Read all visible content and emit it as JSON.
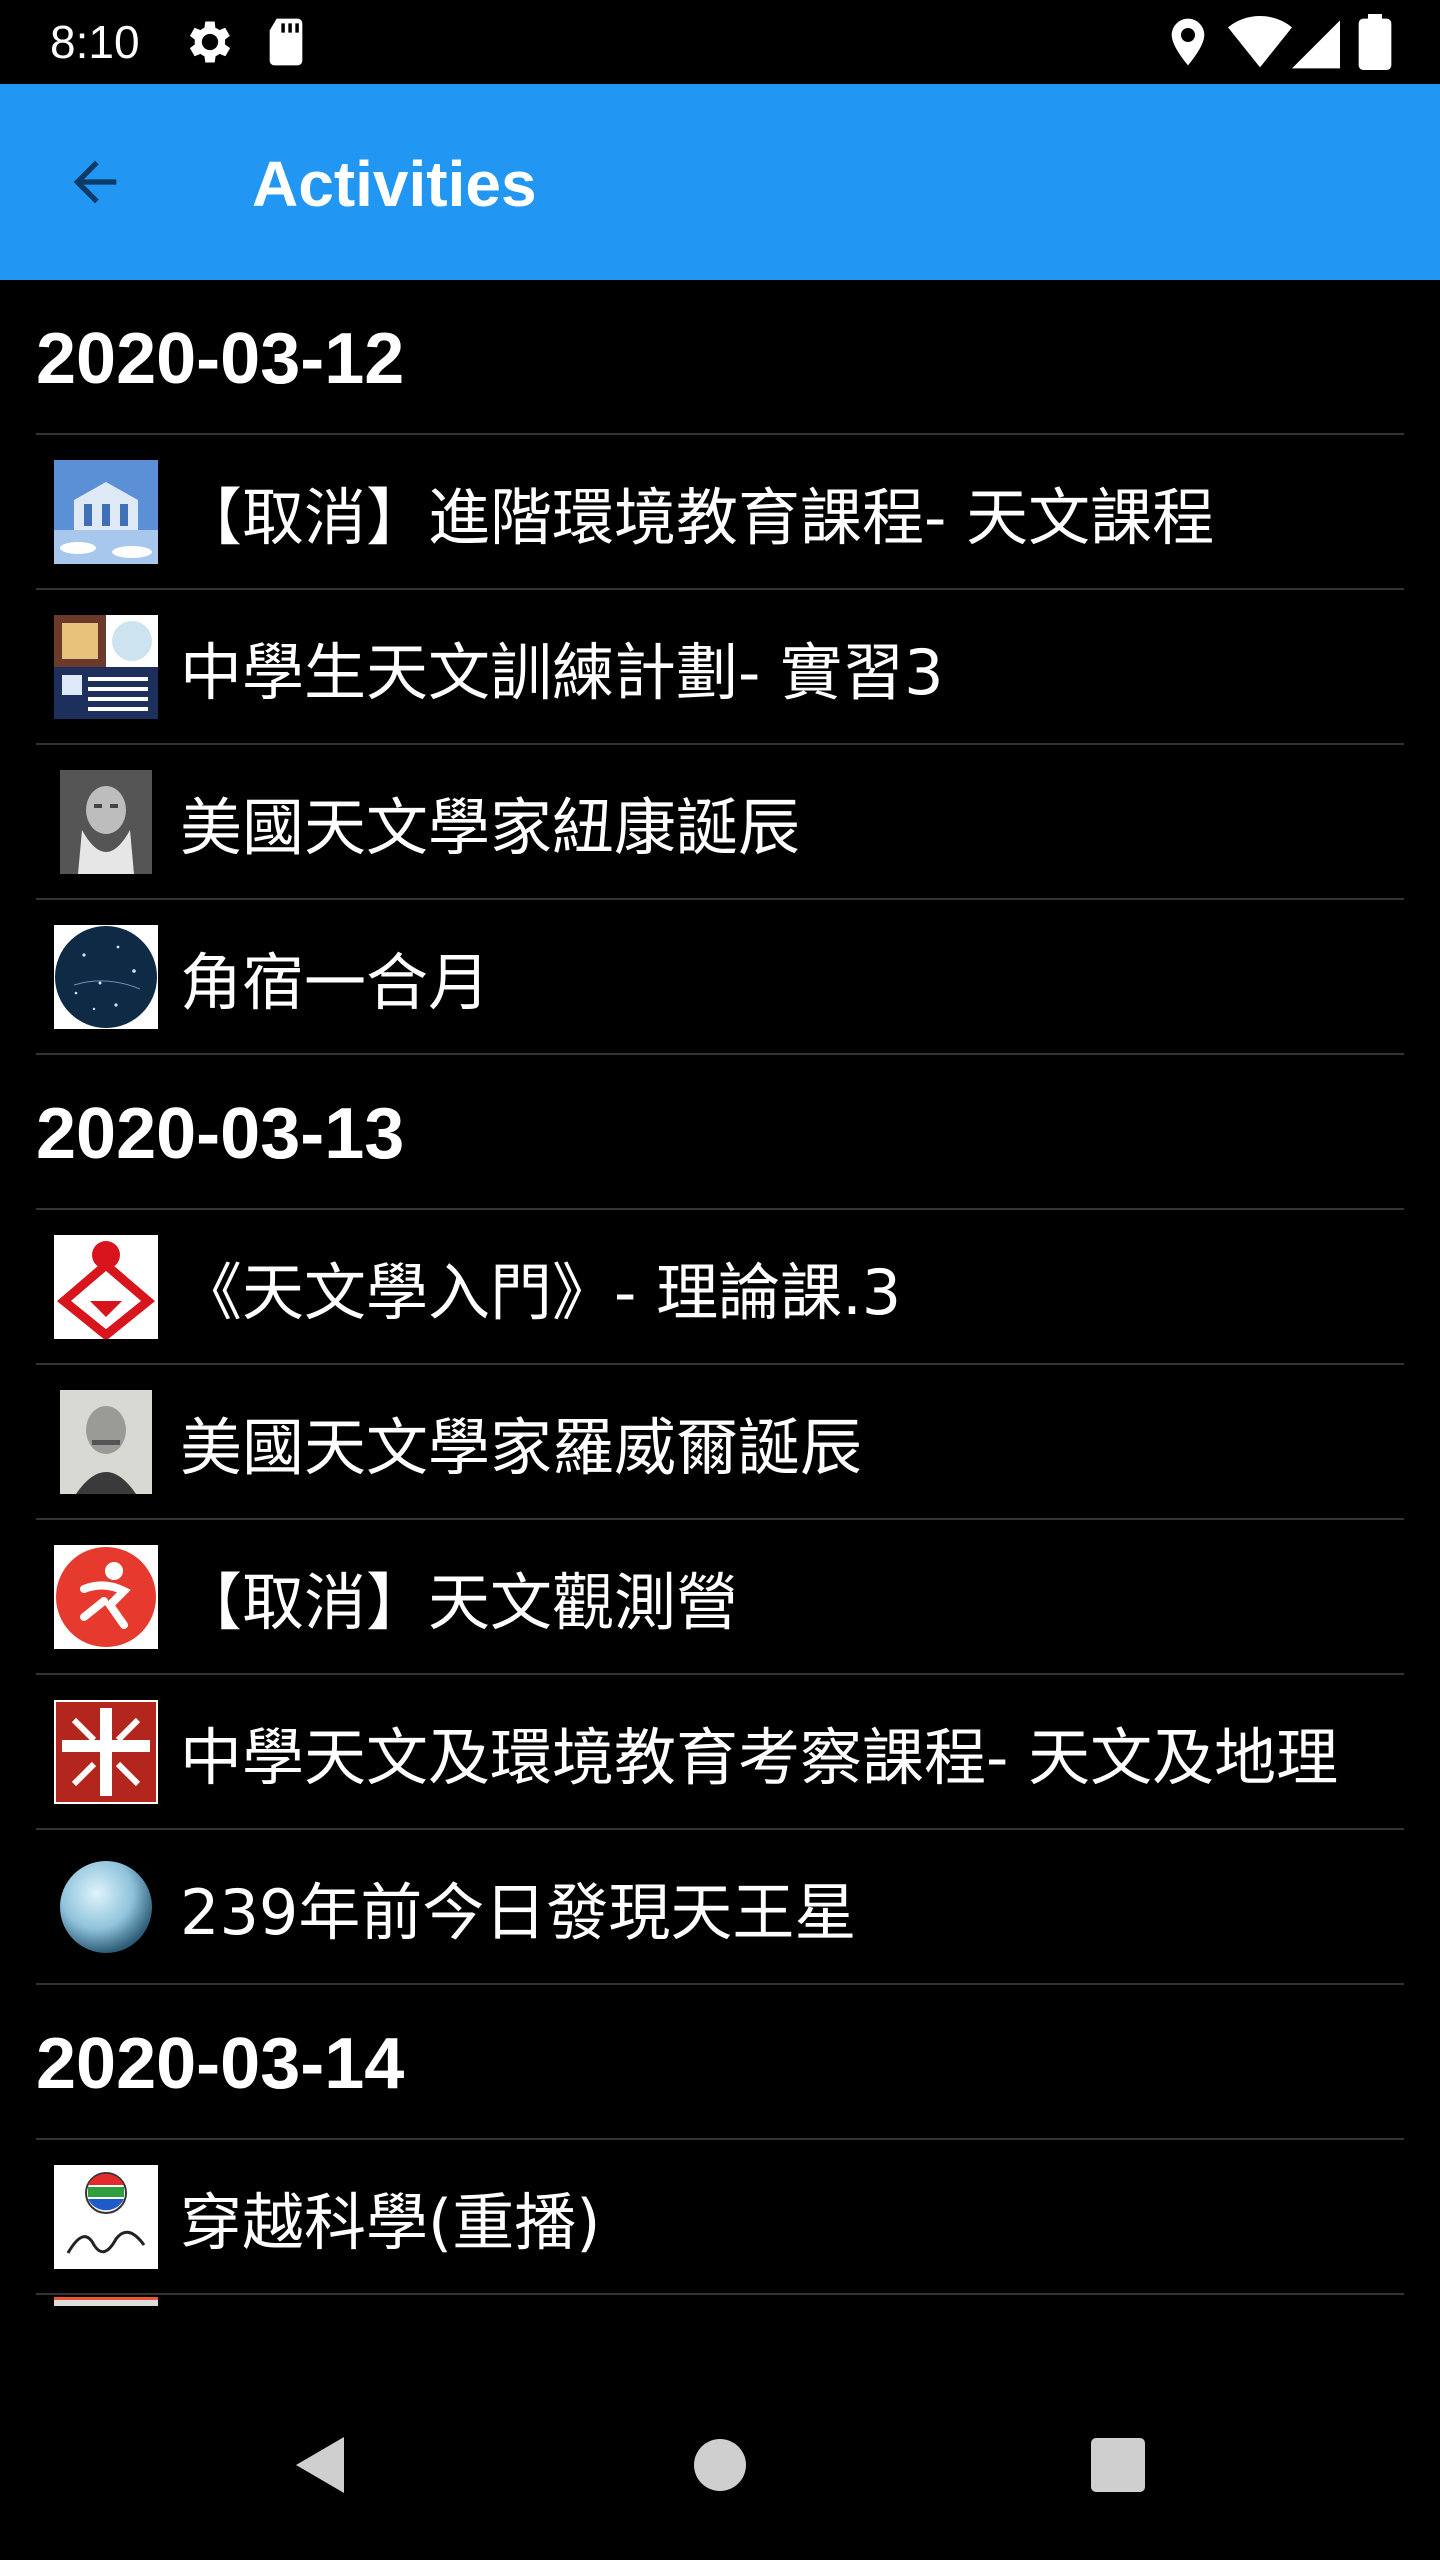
{
  "status_bar": {
    "time": "8:10",
    "icons_left": [
      "gear-icon",
      "sd-card-icon"
    ],
    "icons_right": [
      "location-icon",
      "wifi-icon",
      "signal-icon",
      "battery-icon"
    ]
  },
  "app_bar": {
    "title": "Activities",
    "back_icon": "arrow-back-icon",
    "color": "#2196F3"
  },
  "sections": [
    {
      "date": "2020-03-12",
      "items": [
        {
          "label": "【取消】進階環境教育課程- 天文課程",
          "icon": "building-logo-icon"
        },
        {
          "label": "中學生天文訓練計劃- 實習3",
          "icon": "hkas-logo-icon"
        },
        {
          "label": "美國天文學家紐康誕辰",
          "icon": "portrait-icon"
        },
        {
          "label": "角宿一合月",
          "icon": "star-map-icon"
        }
      ]
    },
    {
      "date": "2020-03-13",
      "items": [
        {
          "label": "《天文學入門》- 理論課.3",
          "icon": "red-diamond-logo-icon"
        },
        {
          "label": "美國天文學家羅威爾誕辰",
          "icon": "portrait-icon"
        },
        {
          "label": "【取消】天文觀測營",
          "icon": "runner-logo-icon"
        },
        {
          "label": "中學天文及環境教育考察課程- 天文及地理",
          "icon": "cross-logo-icon"
        },
        {
          "label": "239年前今日發現天王星",
          "icon": "planet-icon"
        }
      ]
    },
    {
      "date": "2020-03-14",
      "items": [
        {
          "label": "穿越科學(重播)",
          "icon": "pearl-logo-icon"
        }
      ]
    }
  ],
  "nav_bar": {
    "back": "nav-back-icon",
    "home": "nav-home-icon",
    "recents": "nav-recents-icon"
  }
}
